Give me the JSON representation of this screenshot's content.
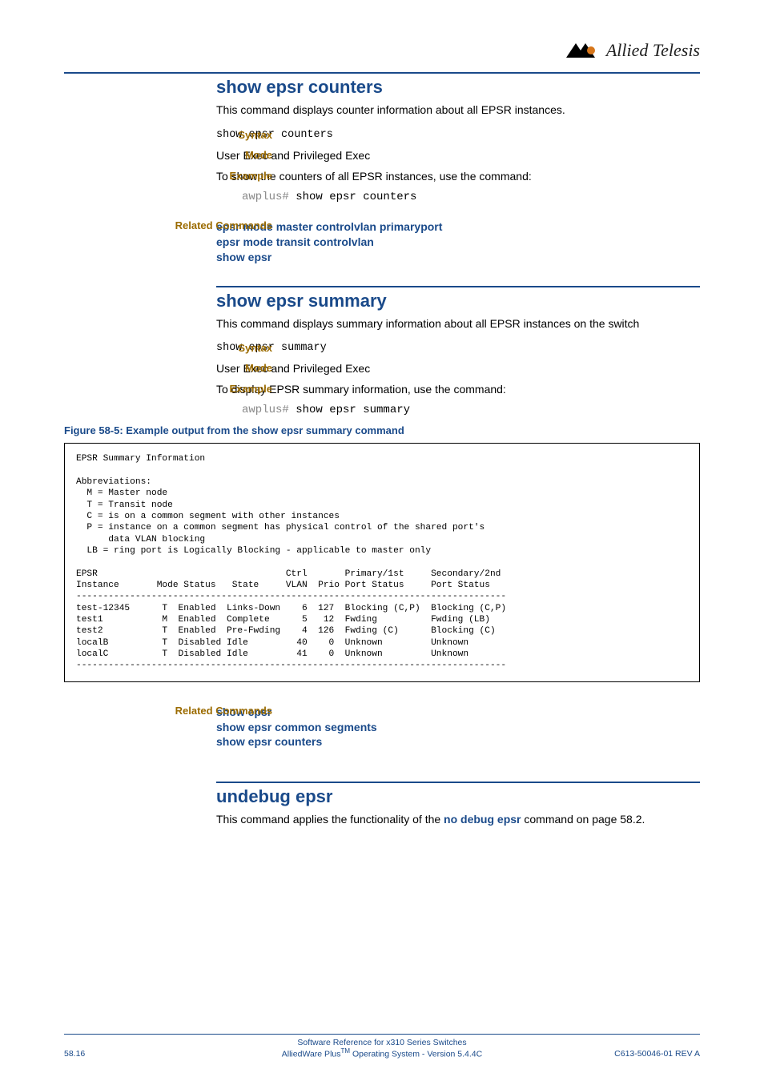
{
  "brand": {
    "name": "Allied Telesis",
    "logo_alt": "allied-telesis-logo"
  },
  "section1": {
    "title": "show epsr counters",
    "intro": "This command displays counter information about all EPSR instances.",
    "syntax_label": "Syntax",
    "syntax_value": "show epsr counters",
    "mode_label": "Mode",
    "mode_value": "User Exec and Privileged Exec",
    "example_label": "Example",
    "example_text": "To show the counters of all EPSR instances, use the command:",
    "example_prompt": "awplus#",
    "example_cmd": "show epsr counters",
    "related_label": "Related Commands",
    "related_links": [
      "epsr mode master controlvlan primaryport",
      "epsr mode transit controlvlan",
      "show epsr"
    ]
  },
  "section2": {
    "title": "show epsr summary",
    "intro": "This command displays summary information about all EPSR instances on the switch",
    "syntax_label": "Syntax",
    "syntax_value": "show epsr summary",
    "mode_label": "Mode",
    "mode_value": "User Exec and Privileged Exec",
    "example_label": "Example",
    "example_text": "To display EPSR summary information, use the command:",
    "example_prompt": "awplus#",
    "example_cmd": "show epsr summary",
    "figure_caption": "Figure 58-5: Example output from the show epsr summary command",
    "output": "EPSR Summary Information\n\nAbbreviations:\n  M = Master node\n  T = Transit node\n  C = is on a common segment with other instances\n  P = instance on a common segment has physical control of the shared port's\n      data VLAN blocking\n  LB = ring port is Logically Blocking - applicable to master only\n\nEPSR                                   Ctrl       Primary/1st     Secondary/2nd\nInstance       Mode Status   State     VLAN  Prio Port Status     Port Status\n--------------------------------------------------------------------------------\ntest-12345      T  Enabled  Links-Down    6  127  Blocking (C,P)  Blocking (C,P)\ntest1           M  Enabled  Complete      5   12  Fwding          Fwding (LB)\ntest2           T  Enabled  Pre-Fwding    4  126  Fwding (C)      Blocking (C)\nlocalB          T  Disabled Idle         40    0  Unknown         Unknown\nlocalC          T  Disabled Idle         41    0  Unknown         Unknown\n--------------------------------------------------------------------------------",
    "related_label": "Related Commands",
    "related_links": [
      "show epsr",
      "show epsr common segments",
      "show epsr counters"
    ]
  },
  "section3": {
    "title": "undebug epsr",
    "intro_prefix": "This command applies the functionality of the ",
    "intro_link": "no debug epsr",
    "intro_suffix": " command on page 58.2."
  },
  "footer": {
    "page": "58.16",
    "line1": "Software Reference for x310 Series Switches",
    "line2_prefix": "AlliedWare Plus",
    "line2_tm": "TM",
    "line2_suffix": " Operating System   - Version 5.4.4C",
    "rev": "C613-50046-01 REV A"
  }
}
